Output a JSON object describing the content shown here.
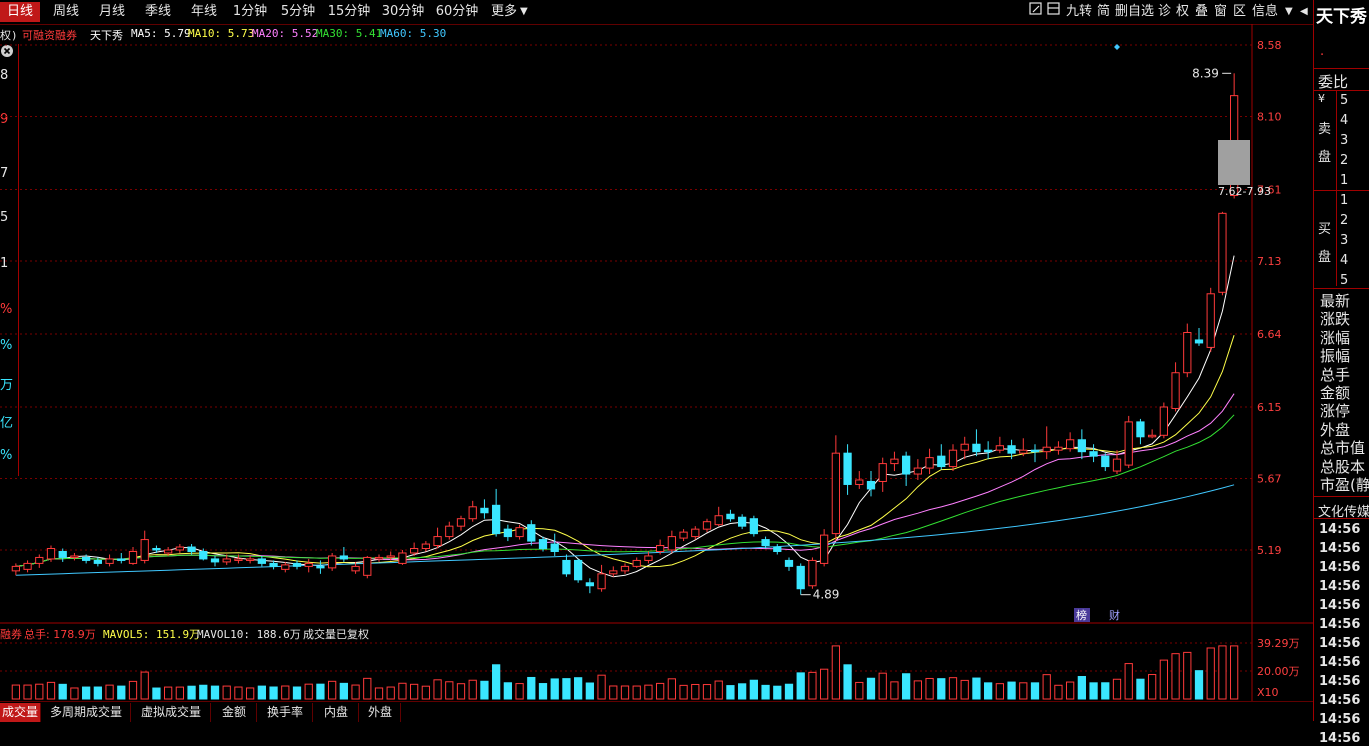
{
  "toolbar": {
    "tabs": [
      "日线",
      "周线",
      "月线",
      "季线",
      "年线",
      "1分钟",
      "5分钟",
      "15分钟",
      "30分钟",
      "60分钟",
      "更多"
    ],
    "active_tab": "日线",
    "tools": [
      "九转",
      "简",
      "删自选",
      "诊",
      "权",
      "叠",
      "窗",
      "区",
      "信息"
    ]
  },
  "stock": {
    "name": "天下秀",
    "tag_left": "权)",
    "margin_tag": "可融资融券",
    "ma": {
      "MA5": "5.79",
      "MA10": "5.73",
      "MA20": "5.52",
      "MA30": "5.41",
      "MA60": "5.30"
    },
    "ma_labels": {
      "ma5": "MA5: 5.79",
      "ma10": "MA10: 5.73",
      "ma20": "MA20: 5.52",
      "ma30": "MA30: 5.41",
      "ma60": "MA60: 5.30"
    }
  },
  "price_axis": {
    "labels": [
      "8.58",
      "8.10",
      "7.61",
      "7.13",
      "6.64",
      "6.15",
      "5.67",
      "5.19"
    ]
  },
  "annotations": {
    "high": "8.39",
    "low": "4.89",
    "range": "7.62-7.93",
    "bang": "榜",
    "cai": "财"
  },
  "volume": {
    "legend_prefix": "融券",
    "total": "总手: 178.9万",
    "mavol5": "MAVOL5: 151.9万",
    "mavol10": "MAVOL10: 188.6万",
    "note": "成交量已复权",
    "axis": [
      "39.29万",
      "20.00万",
      "X10"
    ]
  },
  "bottom_tabs": [
    "成交量",
    "多周期成交量",
    "虚拟成交量",
    "金额",
    "换手率",
    "内盘",
    "外盘"
  ],
  "right_panel": {
    "weibi": "委比",
    "yen": "¥",
    "sell": "卖",
    "sell2": "盘",
    "buy": "买",
    "buy2": "盘",
    "sell_levels": [
      "5",
      "4",
      "3",
      "2",
      "1"
    ],
    "buy_levels": [
      "1",
      "2",
      "3",
      "4",
      "5"
    ],
    "fields": [
      "最新",
      "涨跌",
      "涨幅",
      "振幅",
      "总手",
      "金额",
      "涨停",
      "外盘",
      "总市值",
      "总股本",
      "市盈(静"
    ],
    "industry": "文化传媒",
    "times": [
      "14:56",
      "14:56",
      "14:56",
      "14:56",
      "14:56",
      "14:56",
      "14:56",
      "14:56",
      "14:56",
      "14:56",
      "14:56",
      "14:56"
    ]
  },
  "left_values": [
    "8",
    "9",
    "7",
    "5",
    "1",
    "%",
    "%",
    "万",
    "亿",
    "%"
  ],
  "colors": {
    "up": "#ff3a3a",
    "down": "#3ae6ff",
    "ma5": "#ffffff",
    "ma10": "#ffff4a",
    "ma20": "#ff80ff",
    "ma30": "#33e033",
    "ma60": "#40c8ff",
    "accent": "#c01818"
  },
  "chart_data": {
    "type": "candlestick",
    "ylim": [
      4.7,
      8.7
    ],
    "candles": [
      [
        5.05,
        5.08,
        5.1,
        5.02
      ],
      [
        5.06,
        5.1,
        5.12,
        5.04
      ],
      [
        5.1,
        5.14,
        5.16,
        5.07
      ],
      [
        5.13,
        5.2,
        5.22,
        5.11
      ],
      [
        5.18,
        5.14,
        5.2,
        5.11
      ],
      [
        5.14,
        5.15,
        5.17,
        5.12
      ],
      [
        5.14,
        5.12,
        5.16,
        5.1
      ],
      [
        5.12,
        5.1,
        5.14,
        5.08
      ],
      [
        5.1,
        5.13,
        5.16,
        5.08
      ],
      [
        5.13,
        5.12,
        5.17,
        5.1
      ],
      [
        5.1,
        5.18,
        5.21,
        5.09
      ],
      [
        5.12,
        5.26,
        5.32,
        5.1
      ],
      [
        5.2,
        5.19,
        5.22,
        5.17
      ],
      [
        5.17,
        5.19,
        5.21,
        5.15
      ],
      [
        5.19,
        5.21,
        5.23,
        5.17
      ],
      [
        5.21,
        5.18,
        5.23,
        5.16
      ],
      [
        5.18,
        5.13,
        5.2,
        5.12
      ],
      [
        5.13,
        5.11,
        5.15,
        5.08
      ],
      [
        5.11,
        5.13,
        5.16,
        5.09
      ],
      [
        5.13,
        5.13,
        5.16,
        5.1
      ],
      [
        5.12,
        5.13,
        5.15,
        5.1
      ],
      [
        5.13,
        5.1,
        5.15,
        5.08
      ],
      [
        5.1,
        5.08,
        5.12,
        5.06
      ],
      [
        5.06,
        5.09,
        5.11,
        5.04
      ],
      [
        5.1,
        5.08,
        5.12,
        5.06
      ],
      [
        5.08,
        5.1,
        5.13,
        5.04
      ],
      [
        5.08,
        5.07,
        5.12,
        5.03
      ],
      [
        5.07,
        5.15,
        5.17,
        5.05
      ],
      [
        5.15,
        5.13,
        5.21,
        5.11
      ],
      [
        5.05,
        5.08,
        5.11,
        5.03
      ],
      [
        5.02,
        5.14,
        5.15,
        5.0
      ],
      [
        5.13,
        5.14,
        5.16,
        5.11
      ],
      [
        5.14,
        5.15,
        5.18,
        5.12
      ],
      [
        5.1,
        5.17,
        5.19,
        5.09
      ],
      [
        5.17,
        5.2,
        5.24,
        5.15
      ],
      [
        5.2,
        5.23,
        5.25,
        5.18
      ],
      [
        5.22,
        5.28,
        5.34,
        5.2
      ],
      [
        5.28,
        5.35,
        5.38,
        5.26
      ],
      [
        5.35,
        5.4,
        5.42,
        5.32
      ],
      [
        5.4,
        5.48,
        5.52,
        5.38
      ],
      [
        5.47,
        5.44,
        5.53,
        5.4
      ],
      [
        5.49,
        5.3,
        5.6,
        5.28
      ],
      [
        5.33,
        5.28,
        5.36,
        5.25
      ],
      [
        5.28,
        5.34,
        5.36,
        5.26
      ],
      [
        5.36,
        5.25,
        5.39,
        5.22
      ],
      [
        5.26,
        5.2,
        5.28,
        5.18
      ],
      [
        5.23,
        5.18,
        5.3,
        5.15
      ],
      [
        5.12,
        5.03,
        5.16,
        5.01
      ],
      [
        5.12,
        4.99,
        5.13,
        4.97
      ],
      [
        4.97,
        4.95,
        5.0,
        4.9
      ],
      [
        4.93,
        5.03,
        5.09,
        4.91
      ],
      [
        5.03,
        5.05,
        5.08,
        5.01
      ],
      [
        5.05,
        5.08,
        5.1,
        5.03
      ],
      [
        5.08,
        5.12,
        5.14,
        5.07
      ],
      [
        5.12,
        5.15,
        5.18,
        5.1
      ],
      [
        5.18,
        5.22,
        5.26,
        5.16
      ],
      [
        5.19,
        5.28,
        5.32,
        5.17
      ],
      [
        5.27,
        5.31,
        5.33,
        5.25
      ],
      [
        5.28,
        5.33,
        5.35,
        5.26
      ],
      [
        5.33,
        5.38,
        5.4,
        5.31
      ],
      [
        5.36,
        5.42,
        5.48,
        5.35
      ],
      [
        5.43,
        5.4,
        5.46,
        5.38
      ],
      [
        5.41,
        5.35,
        5.43,
        5.33
      ],
      [
        5.4,
        5.3,
        5.42,
        5.28
      ],
      [
        5.26,
        5.22,
        5.28,
        5.2
      ],
      [
        5.21,
        5.18,
        5.23,
        5.16
      ],
      [
        5.12,
        5.08,
        5.14,
        5.05
      ],
      [
        5.08,
        4.93,
        5.1,
        4.89
      ],
      [
        4.95,
        5.12,
        5.14,
        4.93
      ],
      [
        5.1,
        5.29,
        5.33,
        5.08
      ],
      [
        5.3,
        5.84,
        5.96,
        5.25
      ],
      [
        5.84,
        5.63,
        5.9,
        5.56
      ],
      [
        5.63,
        5.66,
        5.72,
        5.6
      ],
      [
        5.65,
        5.6,
        5.72,
        5.55
      ],
      [
        5.65,
        5.77,
        5.81,
        5.58
      ],
      [
        5.77,
        5.8,
        5.85,
        5.72
      ],
      [
        5.82,
        5.7,
        5.85,
        5.62
      ],
      [
        5.7,
        5.74,
        5.8,
        5.66
      ],
      [
        5.74,
        5.81,
        5.87,
        5.7
      ],
      [
        5.82,
        5.75,
        5.9,
        5.73
      ],
      [
        5.75,
        5.86,
        5.9,
        5.72
      ],
      [
        5.86,
        5.9,
        5.95,
        5.8
      ],
      [
        5.9,
        5.85,
        6.0,
        5.82
      ],
      [
        5.86,
        5.85,
        5.92,
        5.8
      ],
      [
        5.86,
        5.89,
        5.95,
        5.84
      ],
      [
        5.89,
        5.84,
        5.93,
        5.8
      ],
      [
        5.84,
        5.86,
        5.94,
        5.82
      ],
      [
        5.86,
        5.85,
        5.9,
        5.78
      ],
      [
        5.85,
        5.88,
        6.02,
        5.8
      ],
      [
        5.86,
        5.88,
        5.92,
        5.83
      ],
      [
        5.87,
        5.93,
        5.98,
        5.85
      ],
      [
        5.93,
        5.85,
        6.0,
        5.8
      ],
      [
        5.85,
        5.82,
        5.9,
        5.78
      ],
      [
        5.82,
        5.75,
        5.84,
        5.72
      ],
      [
        5.72,
        5.8,
        5.86,
        5.7
      ],
      [
        5.76,
        6.05,
        6.09,
        5.74
      ],
      [
        6.05,
        5.95,
        6.07,
        5.9
      ],
      [
        5.95,
        5.96,
        6.0,
        5.94
      ],
      [
        5.96,
        6.15,
        6.18,
        5.94
      ],
      [
        6.14,
        6.38,
        6.45,
        6.12
      ],
      [
        6.38,
        6.65,
        6.71,
        6.35
      ],
      [
        6.6,
        6.58,
        6.68,
        6.56
      ],
      [
        6.55,
        6.91,
        6.95,
        6.52
      ],
      [
        6.92,
        7.45,
        7.46,
        6.9
      ],
      [
        7.57,
        8.24,
        8.39,
        7.55
      ]
    ]
  }
}
